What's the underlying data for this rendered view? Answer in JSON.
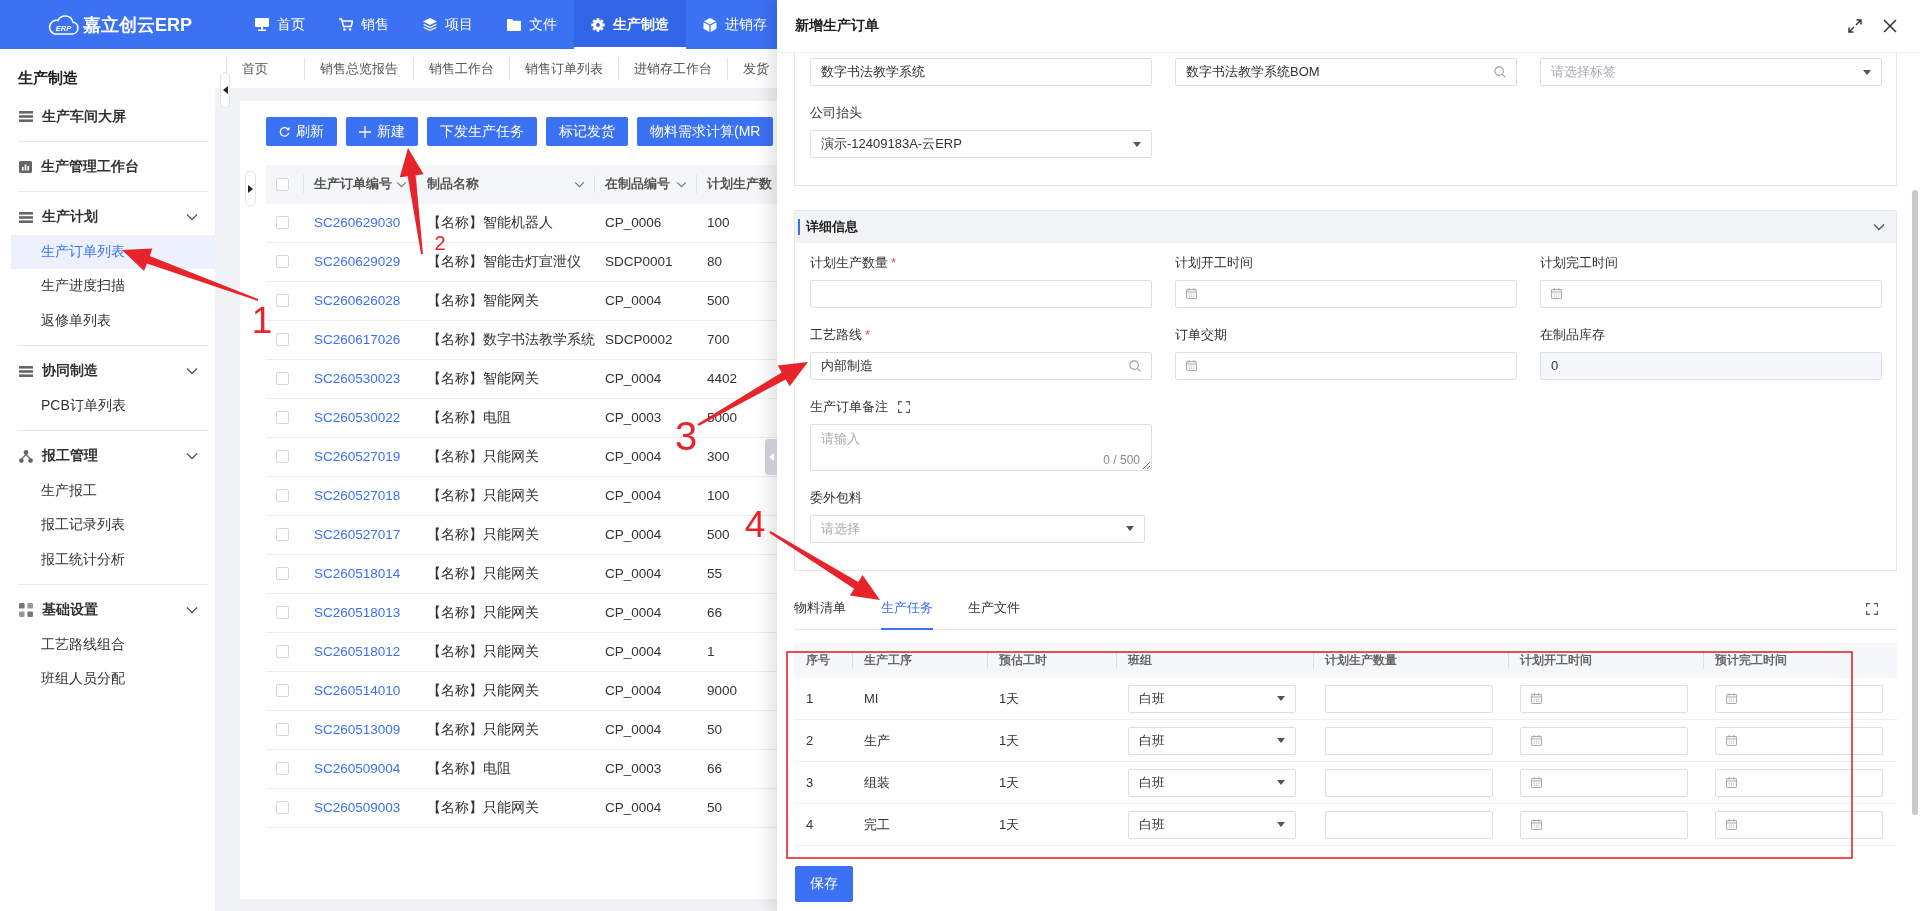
{
  "header": {
    "logo_mark": "ERP",
    "logo_text": "嘉立创云ERP",
    "nav": [
      {
        "label": "首页",
        "selected": false
      },
      {
        "label": "销售",
        "selected": false
      },
      {
        "label": "项目",
        "selected": false
      },
      {
        "label": "文件",
        "selected": false
      },
      {
        "label": "生产制造",
        "selected": true
      },
      {
        "label": "进销存",
        "selected": false
      }
    ]
  },
  "sidebar": {
    "title": "生产制造",
    "items": [
      {
        "kind": "link",
        "label": "生产车间大屏",
        "selected": false
      },
      {
        "kind": "link",
        "label": "生产管理工作台",
        "selected": false
      },
      {
        "kind": "group",
        "label": "生产计划",
        "expanded": true,
        "children": [
          {
            "label": "生产订单列表",
            "selected": true
          },
          {
            "label": "生产进度扫描",
            "selected": false
          },
          {
            "label": "返修单列表",
            "selected": false
          }
        ]
      },
      {
        "kind": "group",
        "label": "协同制造",
        "expanded": true,
        "children": [
          {
            "label": "PCB订单列表",
            "selected": false
          }
        ]
      },
      {
        "kind": "group",
        "label": "报工管理",
        "expanded": true,
        "children": [
          {
            "label": "生产报工",
            "selected": false
          },
          {
            "label": "报工记录列表",
            "selected": false
          },
          {
            "label": "报工统计分析",
            "selected": false
          }
        ]
      },
      {
        "kind": "group",
        "label": "基础设置",
        "expanded": true,
        "children": [
          {
            "label": "工艺路线组合",
            "selected": false
          },
          {
            "label": "班组人员分配",
            "selected": false
          }
        ]
      }
    ]
  },
  "page_tabs": [
    {
      "label": "首页",
      "selected": false
    },
    {
      "label": "销售总览报告",
      "selected": false
    },
    {
      "label": "销售工作台",
      "selected": false
    },
    {
      "label": "销售订单列表",
      "selected": false
    },
    {
      "label": "进销存工作台",
      "selected": false
    },
    {
      "label": "发货",
      "selected": false
    }
  ],
  "toolbar": [
    "刷新",
    "新建",
    "下发生产任务",
    "标记发货",
    "物料需求计算(MR"
  ],
  "orders_table": {
    "all_checked": false,
    "columns": [
      "生产订单编号",
      "制品名称",
      "在制品编号",
      "计划生产数"
    ],
    "rows": [
      {
        "checked": false,
        "cells": [
          "SC260629030",
          "【名称】智能机器人",
          "CP_0006",
          "100"
        ]
      },
      {
        "checked": false,
        "cells": [
          "SC260629029",
          "【名称】智能击灯宣泄仪",
          "SDCP0001",
          "80"
        ]
      },
      {
        "checked": false,
        "cells": [
          "SC260626028",
          "【名称】智能网关",
          "CP_0004",
          "500"
        ]
      },
      {
        "checked": false,
        "cells": [
          "SC260617026",
          "【名称】数字书法教学系统",
          "SDCP0002",
          "700"
        ]
      },
      {
        "checked": false,
        "cells": [
          "SC260530023",
          "【名称】智能网关",
          "CP_0004",
          "4402"
        ]
      },
      {
        "checked": false,
        "cells": [
          "SC260530022",
          "【名称】电阻",
          "CP_0003",
          "5000"
        ]
      },
      {
        "checked": false,
        "cells": [
          "SC260527019",
          "【名称】只能网关",
          "CP_0004",
          "300"
        ]
      },
      {
        "checked": false,
        "cells": [
          "SC260527018",
          "【名称】只能网关",
          "CP_0004",
          "100"
        ]
      },
      {
        "checked": false,
        "cells": [
          "SC260527017",
          "【名称】只能网关",
          "CP_0004",
          "500"
        ]
      },
      {
        "checked": false,
        "cells": [
          "SC260518014",
          "【名称】只能网关",
          "CP_0004",
          "55"
        ]
      },
      {
        "checked": false,
        "cells": [
          "SC260518013",
          "【名称】只能网关",
          "CP_0004",
          "66"
        ]
      },
      {
        "checked": false,
        "cells": [
          "SC260518012",
          "【名称】只能网关",
          "CP_0004",
          "1"
        ]
      },
      {
        "checked": false,
        "cells": [
          "SC260514010",
          "【名称】只能网关",
          "CP_0004",
          "9000"
        ]
      },
      {
        "checked": false,
        "cells": [
          "SC260513009",
          "【名称】只能网关",
          "CP_0004",
          "50"
        ]
      },
      {
        "checked": false,
        "cells": [
          "SC260509004",
          "【名称】电阻",
          "CP_0003",
          "66"
        ]
      },
      {
        "checked": false,
        "cells": [
          "SC260509003",
          "【名称】只能网关",
          "CP_0004",
          "50"
        ]
      }
    ]
  },
  "drawer": {
    "title": "新增生产订单",
    "form_rows": [
      [
        {
          "kind": "text",
          "value": "数字书法教学系统"
        },
        {
          "kind": "search",
          "value": "数字书法教学系统BOM"
        },
        {
          "kind": "select",
          "placeholder": "请选择标签"
        }
      ],
      [
        {
          "label": "公司抬头",
          "kind": "select",
          "value": "演示-12409183A-云ERP"
        }
      ]
    ],
    "details": {
      "title": "详细信息",
      "expanded": true,
      "rows": [
        [
          {
            "label": "计划生产数量",
            "required_mark": "*",
            "kind": "text",
            "disabled": false
          },
          {
            "label": "计划开工时间",
            "kind": "date",
            "disabled": false
          },
          {
            "label": "计划完工时间",
            "kind": "date",
            "disabled": false
          }
        ],
        [
          {
            "label": "工艺路线",
            "required_mark": "*",
            "kind": "search",
            "value": "内部制造",
            "disabled": false
          },
          {
            "label": "订单交期",
            "kind": "date",
            "disabled": false
          },
          {
            "label": "在制品库存",
            "kind": "text",
            "value": "0",
            "disabled": true
          }
        ],
        [
          {
            "label": "生产订单备注",
            "kind": "textarea",
            "expandable": true,
            "placeholder": "请输入",
            "counter": "0 / 500",
            "disabled": false
          }
        ],
        [
          {
            "label": "委外包料",
            "kind": "select",
            "placeholder": "请选择",
            "disabled": false
          }
        ]
      ]
    },
    "tabs": [
      {
        "label": "物料清单",
        "selected": false
      },
      {
        "label": "生产任务",
        "selected": true
      },
      {
        "label": "生产文件",
        "selected": false
      }
    ],
    "tasks_table": {
      "columns": [
        {
          "label": "序号",
          "kind": "text"
        },
        {
          "label": "生产工序",
          "kind": "text"
        },
        {
          "label": "预估工时",
          "kind": "text"
        },
        {
          "label": "班组",
          "kind": "select"
        },
        {
          "label": "计划生产数量",
          "kind": "input"
        },
        {
          "label": "计划开工时间",
          "kind": "date"
        },
        {
          "label": "预计完工时间",
          "kind": "date"
        }
      ],
      "rows": [
        {
          "cells": [
            "1",
            "MI",
            "1天",
            "白班"
          ]
        },
        {
          "cells": [
            "2",
            "生产",
            "1天",
            "白班"
          ]
        },
        {
          "cells": [
            "3",
            "组装",
            "1天",
            "白班"
          ]
        },
        {
          "cells": [
            "4",
            "完工",
            "1天",
            "白班"
          ]
        }
      ]
    },
    "save_button": "保存"
  },
  "annotations": {
    "arrows": [
      {
        "number": "1"
      },
      {
        "number": "2"
      },
      {
        "number": "3"
      },
      {
        "number": "4"
      }
    ],
    "highlight_box": true
  }
}
